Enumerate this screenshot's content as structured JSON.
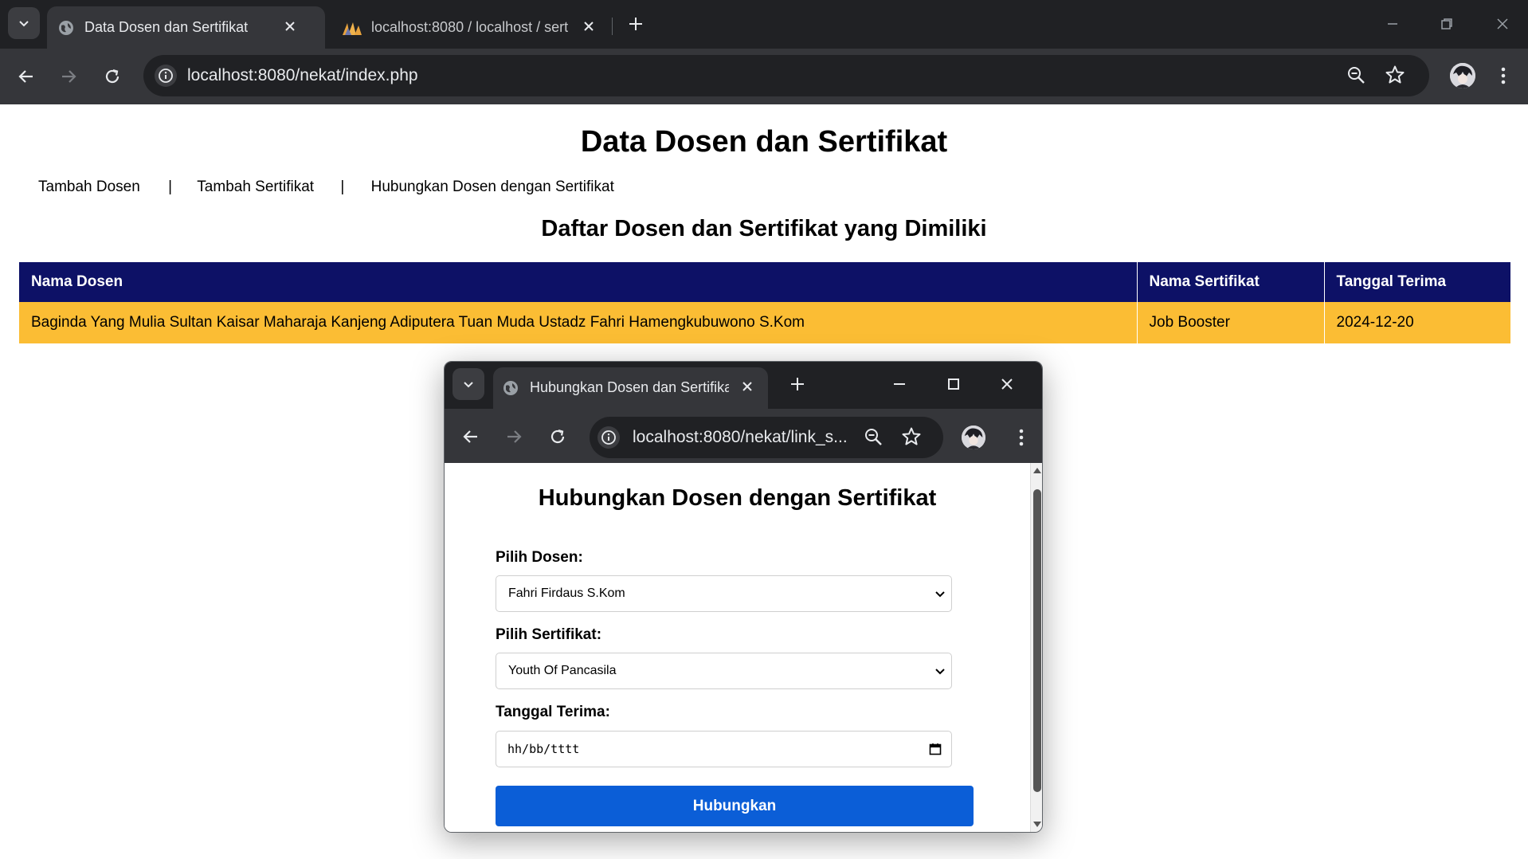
{
  "browser": {
    "tabs": [
      {
        "title": "Data Dosen dan Sertifikat",
        "active": true
      },
      {
        "title": "localhost:8080 / localhost / sert",
        "active": false
      }
    ],
    "url": "localhost:8080/nekat/index.php"
  },
  "page": {
    "title": "Data Dosen dan Sertifikat",
    "nav": [
      {
        "label": "Tambah Dosen"
      },
      {
        "label": "Tambah Sertifikat"
      },
      {
        "label": "Hubungkan Dosen dengan Sertifikat"
      }
    ],
    "nav_separator": "|",
    "section_title": "Daftar Dosen dan Sertifikat yang Dimiliki",
    "table": {
      "headers": [
        "Nama Dosen",
        "Nama Sertifikat",
        "Tanggal Terima"
      ],
      "rows": [
        [
          "Baginda Yang Mulia Sultan Kaisar Maharaja Kanjeng Adiputera Tuan Muda Ustadz Fahri Hamengkubuwono S.Kom",
          "Job Booster",
          "2024-12-20"
        ]
      ]
    }
  },
  "popup": {
    "tab_title": "Hubungkan Dosen dan Sertifika",
    "url": "localhost:8080/nekat/link_s...",
    "heading": "Hubungkan Dosen dengan Sertifikat",
    "form": {
      "dosen_label": "Pilih Dosen:",
      "dosen_value": "Fahri Firdaus S.Kom",
      "sertifikat_label": "Pilih Sertifikat:",
      "sertifikat_value": "Youth Of Pancasila",
      "tanggal_label": "Tanggal Terima:",
      "tanggal_placeholder": "hh/bb/tttt",
      "submit_label": "Hubungkan"
    }
  },
  "colors": {
    "table_header_bg": "#0d1166",
    "table_row_bg": "#fbbd34",
    "button_bg": "#0b5ed7",
    "chrome_dark": "#202124",
    "chrome_toolbar": "#35363a"
  }
}
